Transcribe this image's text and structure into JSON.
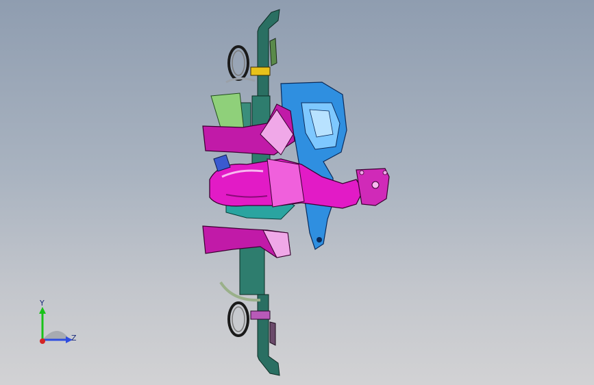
{
  "viewport": {
    "triad": {
      "y_label": "Y",
      "z_label": "Z"
    }
  },
  "colors": {
    "background_top": "#8f9db0",
    "background_bottom": "#d2d2d4",
    "manifold_magenta": "#e21bc6",
    "heat_shield_blue": "#2f8fe0",
    "bracket_teal": "#2e7d6e",
    "light_pink": "#f0a8e8",
    "axis_y": "#19c219",
    "axis_z": "#2f4de0",
    "axis_x": "#d42424"
  },
  "icons": [
    "coordinate-triad-icon"
  ]
}
